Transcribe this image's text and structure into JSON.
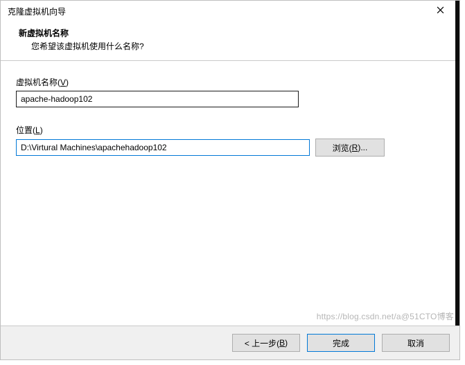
{
  "window": {
    "title": "克隆虚拟机向导"
  },
  "header": {
    "title": "新虚拟机名称",
    "subtitle": "您希望该虚拟机使用什么名称?"
  },
  "fields": {
    "name": {
      "label_pre": "虚拟机名称(",
      "label_mn": "V",
      "label_post": ")",
      "value": "apache-hadoop102"
    },
    "location": {
      "label_pre": "位置(",
      "label_mn": "L",
      "label_post": ")",
      "value": "D:\\Virtural Machines\\apachehadoop102",
      "browse_pre": "浏览(",
      "browse_mn": "R",
      "browse_post": ")..."
    }
  },
  "buttons": {
    "back_pre": "< 上一步(",
    "back_mn": "B",
    "back_post": ")",
    "finish": "完成",
    "cancel": "取消"
  },
  "watermark": "https://blog.csdn.net/a@51CTO博客"
}
